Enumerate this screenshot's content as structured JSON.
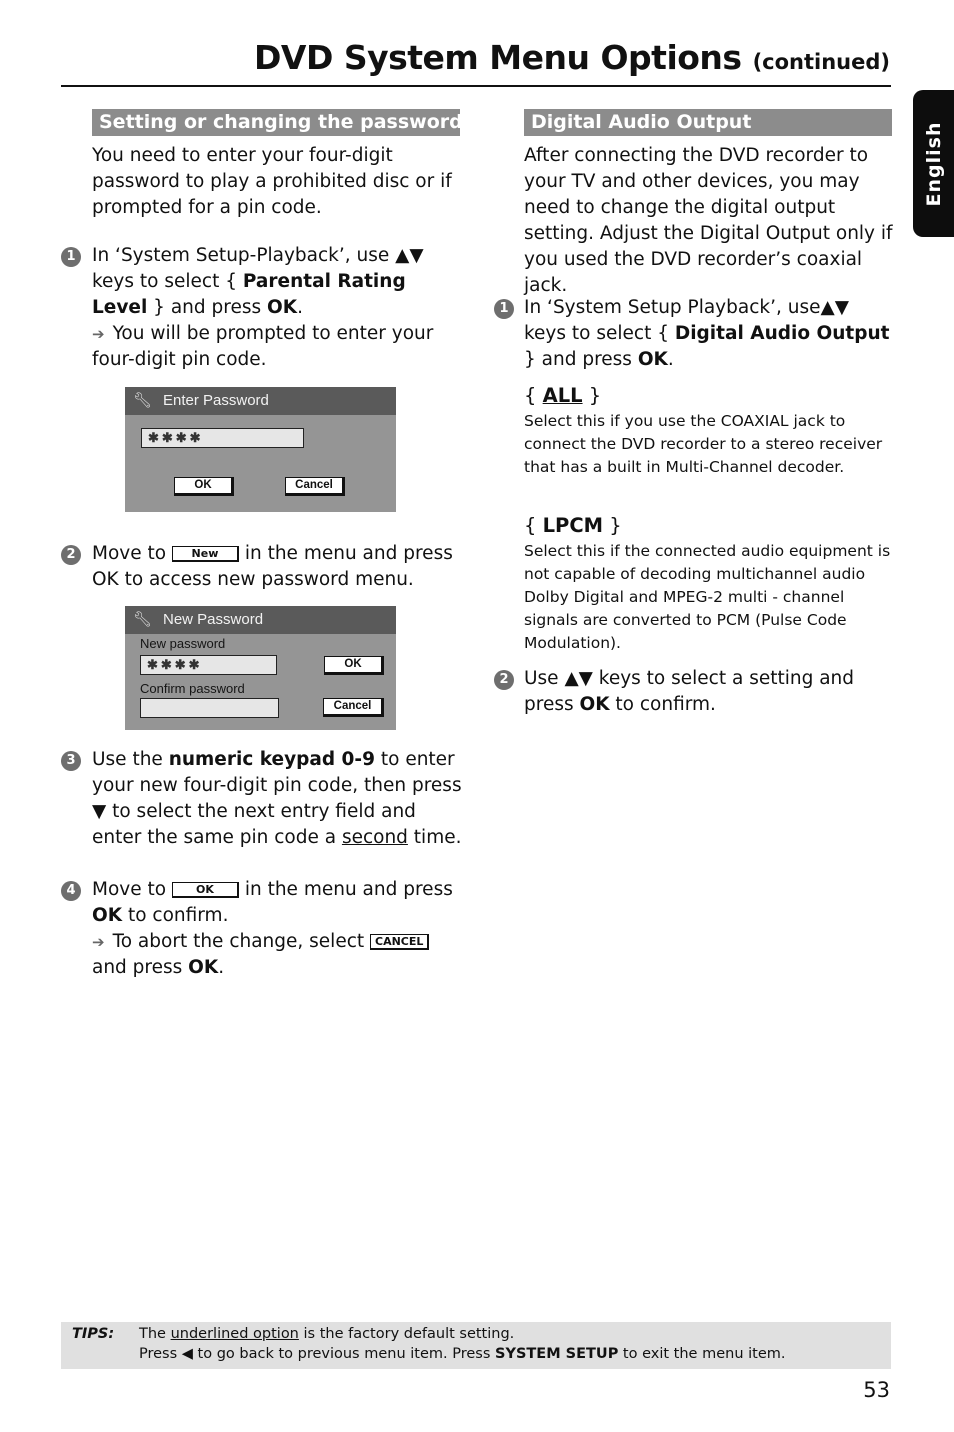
{
  "header": {
    "title": "DVD System Menu Options",
    "continued": "(continued)"
  },
  "language_tab": "English",
  "left": {
    "section_title": "Setting or changing the password",
    "intro": "You need to enter your four-digit password to play a prohibited disc or if prompted for a pin code.",
    "step1": {
      "num": "1",
      "pre": "In ‘System Setup-Playback’, use ▲▼ keys to select { ",
      "bold": "Parental Rating Level",
      "mid": " } and press ",
      "ok": "OK",
      "end": ".",
      "result": "You will be prompted to enter your four-digit pin code."
    },
    "dialog1": {
      "title": "Enter Password",
      "icon": "wrench-icon",
      "field_value": "✱✱✱✱",
      "ok_label": "OK",
      "cancel_label": "Cancel"
    },
    "step2": {
      "num": "2",
      "pre": "Move to ",
      "button": "New",
      "post": " in the menu and press OK to access new password menu."
    },
    "dialog2": {
      "title": "New Password",
      "icon": "wrench-icon",
      "new_label": "New password",
      "new_value": "✱✱✱✱",
      "confirm_label": "Confirm password",
      "confirm_value": "",
      "ok_label": "OK",
      "cancel_label": "Cancel"
    },
    "step3": {
      "num": "3",
      "pre": "Use the ",
      "bold": "numeric keypad 0-9",
      "mid": " to enter your new four-digit pin code, then press ▼ to select the next entry field and enter the same pin code a ",
      "underline": "second",
      "end": " time."
    },
    "step4": {
      "num": "4",
      "pre": "Move to ",
      "button": "OK",
      "post": " in the menu and press ",
      "ok": "OK",
      "end": " to confirm.",
      "result_pre": "To abort the change, select ",
      "result_button": "CANCEL",
      "result_post": " and press ",
      "result_ok": "OK",
      "result_end": "."
    }
  },
  "right": {
    "section_title": "Digital Audio Output",
    "intro": "After connecting the DVD recorder to your TV and other devices, you may need to change the digital output setting. Adjust the Digital Output only if you used the DVD recorder’s coaxial jack.",
    "step1": {
      "num": "1",
      "pre": "In ‘System Setup Playback’, use▲▼ keys to select { ",
      "bold": "Digital Audio Output",
      "mid": " } and press ",
      "ok": "OK",
      "end": "."
    },
    "options": [
      {
        "name": "ALL",
        "default": true,
        "desc": "Select this if you use the COAXIAL jack to connect the DVD recorder to a stereo receiver that has a built in Multi-Channel decoder."
      },
      {
        "name": "LPCM",
        "default": false,
        "desc": "Select this if the connected audio equipment is not capable of decoding multichannel audio Dolby Digital and MPEG-2 multi - channel signals are converted to PCM (Pulse Code Modulation)."
      }
    ],
    "step2": {
      "num": "2",
      "pre": "Use ▲▼ keys to select a setting and press ",
      "ok": "OK",
      "end": " to confirm."
    }
  },
  "tips": {
    "label": "TIPS:",
    "line1_pre": "The ",
    "line1_underline": "underlined option",
    "line1_post": " is the factory default setting.",
    "line2_pre": "Press ◀ to go back to previous menu item. Press ",
    "line2_bold": "SYSTEM SETUP",
    "line2_post": " to exit the menu item."
  },
  "page_number": "53"
}
